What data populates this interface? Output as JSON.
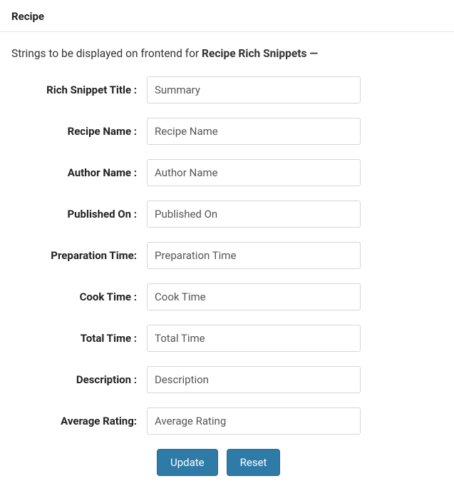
{
  "header": {
    "title": "Recipe"
  },
  "intro": {
    "prefix": "Strings to be displayed on frontend for ",
    "bold": "Recipe Rich Snippets —"
  },
  "fields": [
    {
      "label": "Rich Snippet Title :",
      "value": "Summary",
      "name": "rich-snippet-title"
    },
    {
      "label": "Recipe Name :",
      "value": "Recipe Name",
      "name": "recipe-name"
    },
    {
      "label": "Author Name :",
      "value": "Author Name",
      "name": "author-name"
    },
    {
      "label": "Published On :",
      "value": "Published On",
      "name": "published-on"
    },
    {
      "label": "Preparation Time:",
      "value": "Preparation Time",
      "name": "preparation-time"
    },
    {
      "label": "Cook Time :",
      "value": "Cook Time",
      "name": "cook-time"
    },
    {
      "label": "Total Time :",
      "value": "Total Time",
      "name": "total-time"
    },
    {
      "label": "Description :",
      "value": "Description",
      "name": "description"
    },
    {
      "label": "Average Rating:",
      "value": "Average Rating",
      "name": "average-rating"
    }
  ],
  "buttons": {
    "update": "Update",
    "reset": "Reset"
  }
}
